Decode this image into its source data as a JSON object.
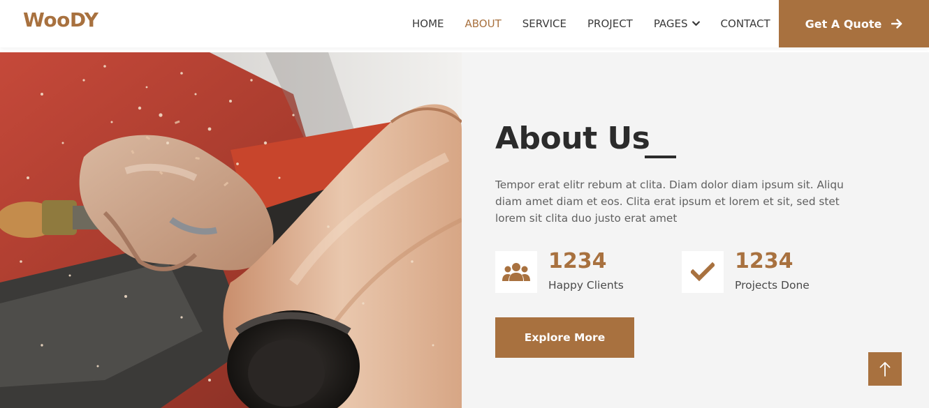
{
  "brand": "WooDY",
  "nav": {
    "items": [
      {
        "label": "HOME"
      },
      {
        "label": "ABOUT"
      },
      {
        "label": "SERVICE"
      },
      {
        "label": "PROJECT"
      },
      {
        "label": "PAGES"
      },
      {
        "label": "CONTACT"
      }
    ],
    "active_index": 1,
    "quote_label": "Get A Quote"
  },
  "about": {
    "title": "About Us",
    "description": "Tempor erat elitr rebum at clita. Diam dolor diam ipsum sit. Aliqu diam amet diam et eos. Clita erat ipsum et lorem et sit, sed stet lorem sit clita duo justo erat amet",
    "stats": [
      {
        "number": "1234",
        "label": "Happy Clients",
        "icon": "users-icon"
      },
      {
        "number": "1234",
        "label": "Projects Done",
        "icon": "check-icon"
      }
    ],
    "button_label": "Explore More"
  },
  "hero_image": {
    "icon": "woodturning-photo"
  },
  "colors": {
    "accent": "#a8713f",
    "heading": "#2b2b2b",
    "content_bg": "#f4f4f4"
  }
}
